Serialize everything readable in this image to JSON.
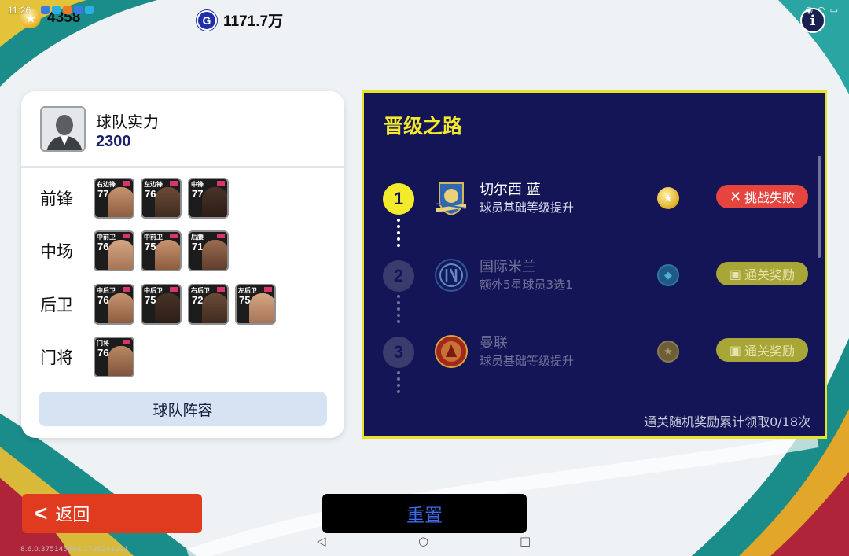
{
  "status_bar": {
    "time": "11:26"
  },
  "currencies": {
    "gold_icon": "star-coin-icon",
    "gold_value": "4358",
    "g_icon_letter": "G",
    "g_value": "1171.7万"
  },
  "info_icon_letter": "i",
  "team": {
    "strength_label": "球队实力",
    "strength_value": "2300",
    "lineup_button": "球队阵容",
    "positions": [
      {
        "label": "前锋",
        "players": [
          {
            "role": "右边锋",
            "rating": "77"
          },
          {
            "role": "左边锋",
            "rating": "76"
          },
          {
            "role": "中锋",
            "rating": "77"
          }
        ]
      },
      {
        "label": "中场",
        "players": [
          {
            "role": "中前卫",
            "rating": "76"
          },
          {
            "role": "中前卫",
            "rating": "75"
          },
          {
            "role": "后腰",
            "rating": "71"
          }
        ]
      },
      {
        "label": "后卫",
        "players": [
          {
            "role": "中后卫",
            "rating": "76"
          },
          {
            "role": "中后卫",
            "rating": "75"
          },
          {
            "role": "右后卫",
            "rating": "72"
          },
          {
            "role": "左后卫",
            "rating": "75"
          }
        ]
      },
      {
        "label": "门将",
        "players": [
          {
            "role": "门将",
            "rating": "76"
          }
        ]
      }
    ]
  },
  "road": {
    "title": "晋级之路",
    "stages": [
      {
        "number": "1",
        "club": "切尔西 蓝",
        "reward": "球员基础等级提升",
        "medal_icon": "gold-star-medal-icon",
        "action": "挑战失败",
        "action_icon": "x-icon",
        "state": "failed"
      },
      {
        "number": "2",
        "club": "国际米兰",
        "reward": "额外5星球员3选1",
        "medal_icon": "ticket-medal-icon",
        "action": "通关奖励",
        "action_icon": "gift-icon",
        "state": "locked"
      },
      {
        "number": "3",
        "club": "曼联",
        "reward": "球员基础等级提升",
        "medal_icon": "bronze-star-medal-icon",
        "action": "通关奖励",
        "action_icon": "gift-icon",
        "state": "locked"
      }
    ],
    "reward_count": "通关随机奖励累计领取0/18次"
  },
  "buttons": {
    "back": "返回",
    "reset": "重置"
  },
  "version": "8.6.0.375145603.1726241201",
  "colors": {
    "panel_bg": "#141556",
    "panel_border": "#e8e22a",
    "fail_red": "#e6443f",
    "reward_olive": "#a7a636",
    "back_red": "#e03b1e"
  }
}
